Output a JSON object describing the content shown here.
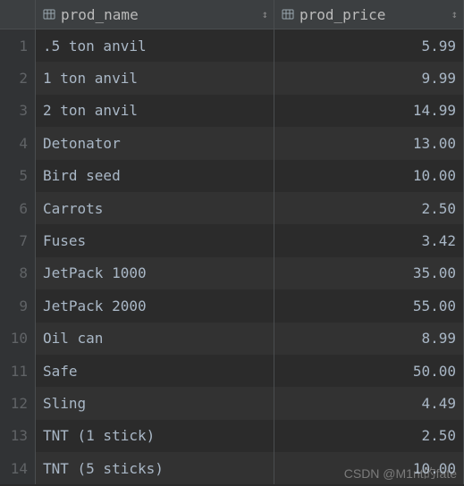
{
  "columns": [
    {
      "name": "prod_name",
      "align": "left"
    },
    {
      "name": "prod_price",
      "align": "right"
    }
  ],
  "rows": [
    {
      "n": "1",
      "prod_name": ".5 ton anvil",
      "prod_price": "5.99"
    },
    {
      "n": "2",
      "prod_name": "1 ton anvil",
      "prod_price": "9.99"
    },
    {
      "n": "3",
      "prod_name": "2 ton anvil",
      "prod_price": "14.99"
    },
    {
      "n": "4",
      "prod_name": "Detonator",
      "prod_price": "13.00"
    },
    {
      "n": "5",
      "prod_name": "Bird seed",
      "prod_price": "10.00"
    },
    {
      "n": "6",
      "prod_name": "Carrots",
      "prod_price": "2.50"
    },
    {
      "n": "7",
      "prod_name": "Fuses",
      "prod_price": "3.42"
    },
    {
      "n": "8",
      "prod_name": "JetPack 1000",
      "prod_price": "35.00"
    },
    {
      "n": "9",
      "prod_name": "JetPack 2000",
      "prod_price": "55.00"
    },
    {
      "n": "10",
      "prod_name": "Oil can",
      "prod_price": "8.99"
    },
    {
      "n": "11",
      "prod_name": "Safe",
      "prod_price": "50.00"
    },
    {
      "n": "12",
      "prod_name": "Sling",
      "prod_price": "4.49"
    },
    {
      "n": "13",
      "prod_name": "TNT (1 stick)",
      "prod_price": "2.50"
    },
    {
      "n": "14",
      "prod_name": "TNT (5 sticks)",
      "prod_price": "10.00"
    }
  ],
  "sort_glyph": "↕",
  "watermark": "CSDN @M1nt的fate"
}
